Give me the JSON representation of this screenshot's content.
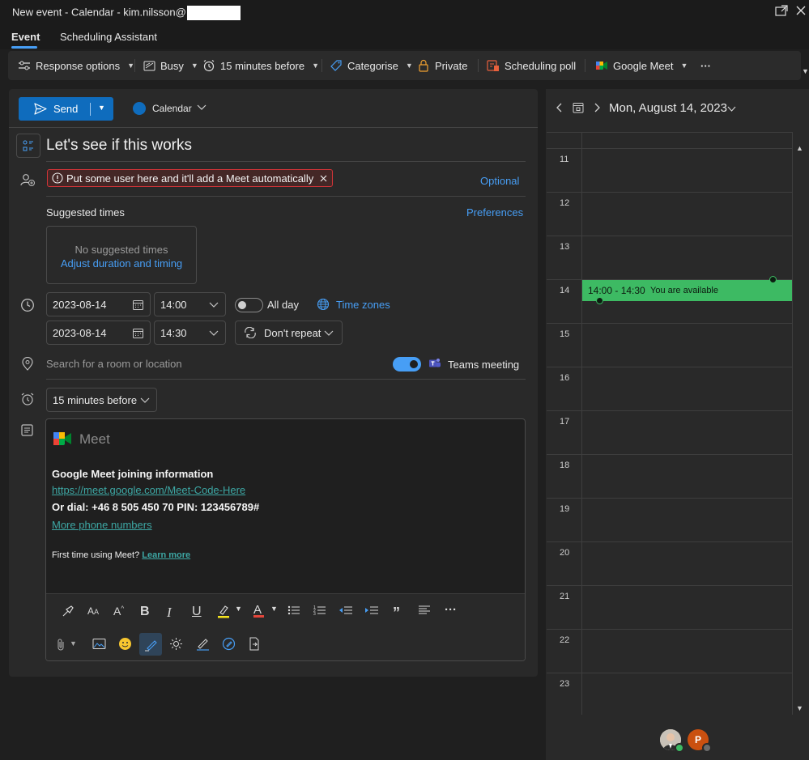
{
  "window": {
    "title": "New event - Calendar - kim.nilsson@"
  },
  "tabs": {
    "event": "Event",
    "scheduling": "Scheduling Assistant"
  },
  "ribbon": {
    "response_options": "Response options",
    "busy": "Busy",
    "reminder": "15 minutes before",
    "categorise": "Categorise",
    "private": "Private",
    "scheduling_poll": "Scheduling poll",
    "google_meet": "Google Meet",
    "more": "···"
  },
  "compose": {
    "send_label": "Send",
    "calendar_label": "Calendar",
    "subject": "Let's see if this works",
    "attendee_chip": "Put some user here and it'll add a Meet automatically",
    "optional_label": "Optional",
    "suggested_times_label": "Suggested times",
    "preferences_label": "Preferences",
    "no_suggested": "No suggested times",
    "adjust_duration": "Adjust duration and timing",
    "start_date": "2023-08-14",
    "start_time": "14:00",
    "end_date": "2023-08-14",
    "end_time": "14:30",
    "all_day_label": "All day",
    "time_zones_label": "Time zones",
    "repeat_label": "Don't repeat",
    "location_placeholder": "Search for a room or location",
    "teams_meeting_label": "Teams meeting",
    "reminder_value": "15 minutes before"
  },
  "body": {
    "meet_logo_text": "Meet",
    "heading": "Google Meet joining information",
    "meet_link": "https://meet.google.com/Meet-Code-Here",
    "dial_text": "Or dial: +46 8 505 450 70 PIN: 123456789#",
    "more_numbers": "More phone numbers",
    "first_time": "First time using Meet?",
    "learn_more": "Learn more"
  },
  "calendar": {
    "date_label": "Mon, August 14, 2023",
    "hours": [
      "11",
      "12",
      "13",
      "14",
      "15",
      "16",
      "17",
      "18",
      "19",
      "20",
      "21",
      "22",
      "23"
    ],
    "event_time": "14:00 - 14:30",
    "event_status": "You are available",
    "avatar_p": "P"
  },
  "colors": {
    "accent": "#0f6cbd",
    "link": "#479ef5",
    "available": "#3dba63",
    "error": "#d13438"
  }
}
